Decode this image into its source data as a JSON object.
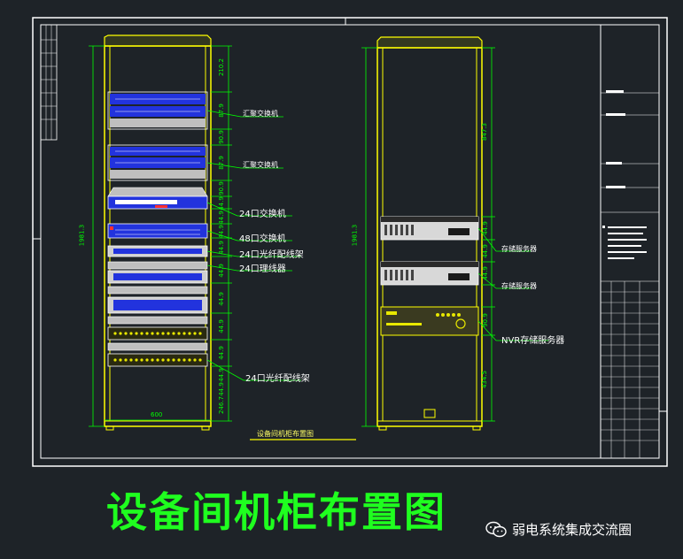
{
  "title": "设备间机柜布置图",
  "drawing_caption": "设备间机柜布置图",
  "watermark": {
    "text": "弱电系统集成交流圈",
    "icon": "wechat-icon"
  },
  "left_cabinet": {
    "width_dim": "600",
    "height_dim": "1981.3",
    "side_dims": [
      "210.2",
      "87.9",
      "90.9",
      "87.9",
      "90.9",
      "44.9",
      "44.9",
      "44.9",
      "44.9",
      "44.9",
      "44.9",
      "44.9",
      "44.9",
      "44.9",
      "44.9",
      "246.7"
    ],
    "equipment_labels": [
      "汇聚交换机",
      "汇聚交换机",
      "24口交换机",
      "48口交换机",
      "24口光纤配线架",
      "24口理线器",
      "24口光纤配线架"
    ]
  },
  "right_cabinet": {
    "height_dim": "1981.3",
    "side_dims": [
      "847.3",
      "44.9",
      "44.9",
      "44.9",
      "90.9",
      "434.5"
    ],
    "equipment_labels": [
      "存储服务器",
      "存储服务器",
      "NVR存储服务器"
    ]
  },
  "colors": {
    "background": "#1e2328",
    "frame": "#ffffff",
    "cabinet": "#ffff00",
    "dimension": "#00ff00",
    "equipment_blue": "#2233dd",
    "title": "#1fff1f"
  }
}
